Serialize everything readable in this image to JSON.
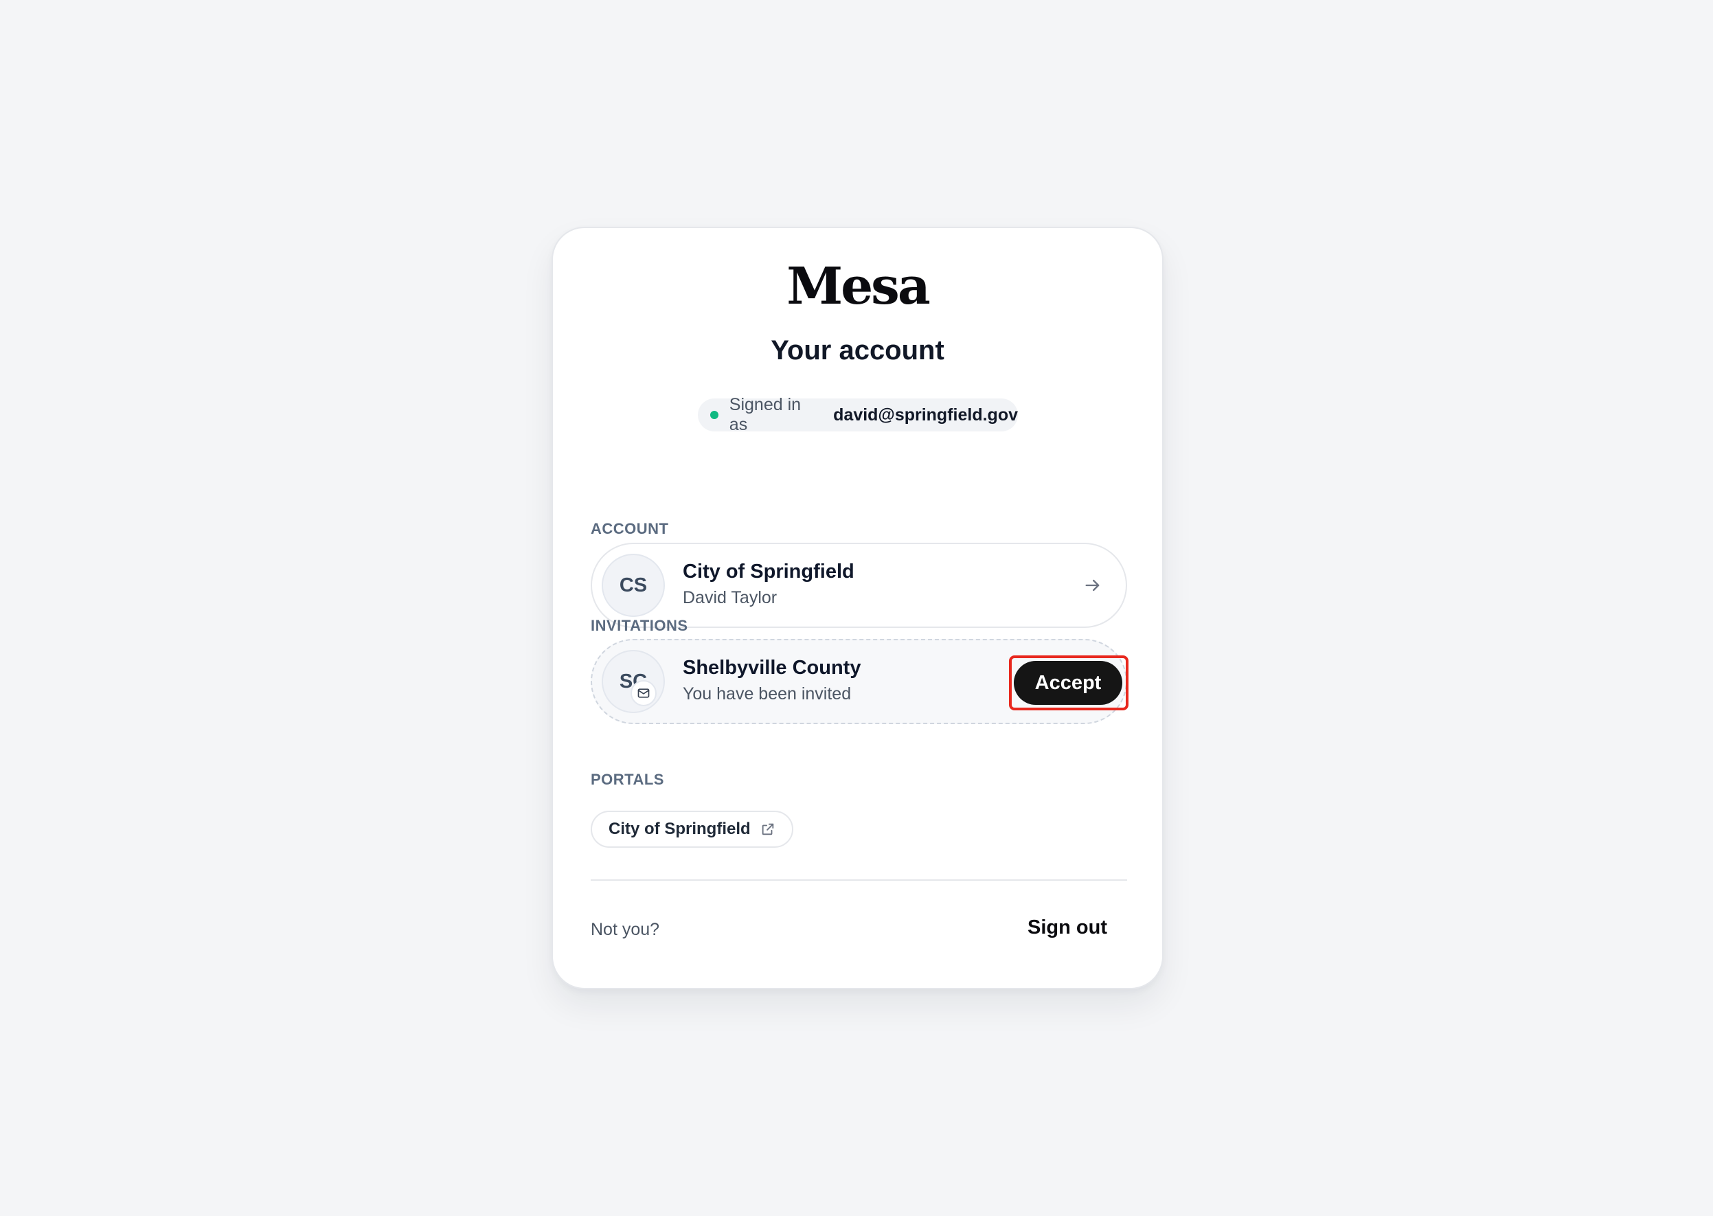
{
  "brand": {
    "logo_text": "Mesa"
  },
  "page": {
    "title": "Your account"
  },
  "session": {
    "signed_in_label": "Signed in as",
    "email": "david@springfield.gov",
    "status_color": "#10b981"
  },
  "account_section": {
    "label": "ACCOUNT",
    "item": {
      "initials": "CS",
      "name": "City of Springfield",
      "user": "David Taylor",
      "icon": "arrow-right-icon"
    }
  },
  "invitations_section": {
    "label": "INVITATIONS",
    "item": {
      "initials": "SC",
      "name": "Shelbyville County",
      "status": "You have been invited",
      "badge_icon": "mail-icon",
      "accept_label": "Accept"
    }
  },
  "portals_section": {
    "label": "PORTALS",
    "items": [
      {
        "name": "City of Springfield",
        "icon": "external-link-icon"
      }
    ]
  },
  "footer": {
    "not_you": "Not you?",
    "sign_out_label": "Sign out"
  },
  "colors": {
    "accent_button": "#151515",
    "highlight": "#e8281e"
  }
}
